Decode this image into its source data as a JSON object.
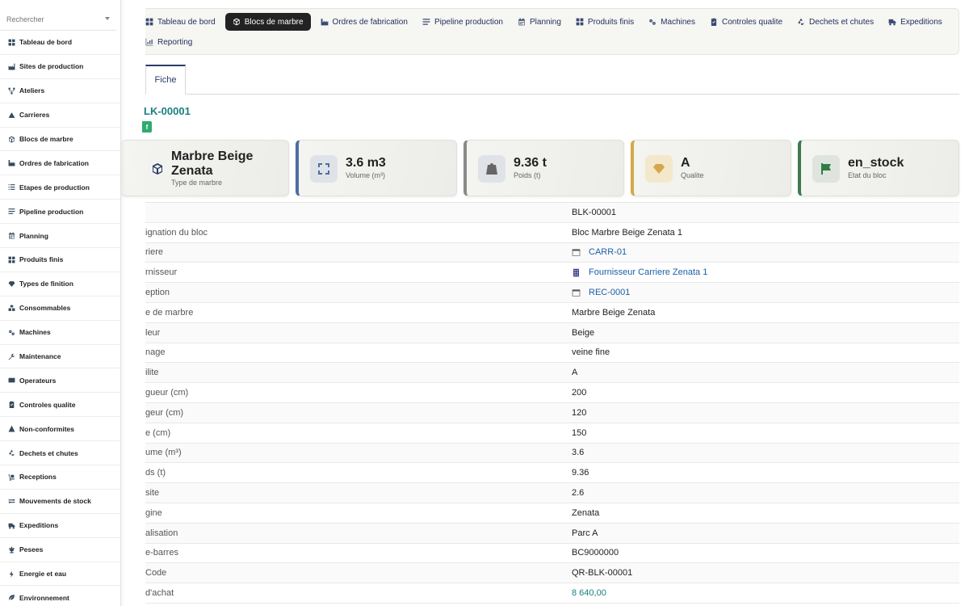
{
  "sidebar": {
    "search_placeholder": "Rechercher",
    "items": [
      {
        "label": "Tableau de bord",
        "icon": "dashboard-icon"
      },
      {
        "label": "Sites de production",
        "icon": "factory-icon"
      },
      {
        "label": "Ateliers",
        "icon": "network-icon"
      },
      {
        "label": "Carrieres",
        "icon": "mountain-icon"
      },
      {
        "label": "Blocs de marbre",
        "icon": "cube-icon"
      },
      {
        "label": "Ordres de fabrication",
        "icon": "industry-icon"
      },
      {
        "label": "Etapes de production",
        "icon": "list-icon"
      },
      {
        "label": "Pipeline production",
        "icon": "bars-icon"
      },
      {
        "label": "Planning",
        "icon": "calendar-icon"
      },
      {
        "label": "Produits finis",
        "icon": "grid-icon"
      },
      {
        "label": "Types de finition",
        "icon": "gem-icon"
      },
      {
        "label": "Consommables",
        "icon": "boxes-icon"
      },
      {
        "label": "Machines",
        "icon": "gears-icon"
      },
      {
        "label": "Maintenance",
        "icon": "wrench-icon"
      },
      {
        "label": "Operateurs",
        "icon": "id-card-icon"
      },
      {
        "label": "Controles qualite",
        "icon": "clipboard-check-icon"
      },
      {
        "label": "Non-conformites",
        "icon": "warning-icon"
      },
      {
        "label": "Dechets et chutes",
        "icon": "recycle-icon"
      },
      {
        "label": "Receptions",
        "icon": "dolly-icon"
      },
      {
        "label": "Mouvements de stock",
        "icon": "exchange-icon"
      },
      {
        "label": "Expeditions",
        "icon": "truck-icon"
      },
      {
        "label": "Pesees",
        "icon": "scale-icon"
      },
      {
        "label": "Energie et eau",
        "icon": "bolt-icon"
      },
      {
        "label": "Environnement",
        "icon": "leaf-icon"
      }
    ]
  },
  "topnav": {
    "row1": [
      {
        "label": "Tableau de bord",
        "icon": "dashboard-icon",
        "active": false
      },
      {
        "label": "Blocs de marbre",
        "icon": "cube-icon",
        "active": true
      },
      {
        "label": "Ordres de fabrication",
        "icon": "industry-icon",
        "active": false
      },
      {
        "label": "Pipeline production",
        "icon": "bars-icon",
        "active": false
      },
      {
        "label": "Planning",
        "icon": "calendar-icon",
        "active": false
      },
      {
        "label": "Produits finis",
        "icon": "grid-icon",
        "active": false
      },
      {
        "label": "Machines",
        "icon": "gears-icon",
        "active": false
      },
      {
        "label": "Controles qualite",
        "icon": "clipboard-check-icon",
        "active": false
      },
      {
        "label": "Dechets et chutes",
        "icon": "recycle-icon",
        "active": false
      },
      {
        "label": "Expeditions",
        "icon": "truck-icon",
        "active": false
      }
    ],
    "row2": [
      {
        "label": "Reporting",
        "icon": "chart-icon",
        "active": false
      }
    ]
  },
  "tabs": {
    "fiche": "Fiche"
  },
  "record": {
    "code": "LK-00001",
    "badge": "f"
  },
  "kpis": [
    {
      "value": "Marbre Beige Zenata",
      "label": "Type de marbre",
      "icon": "cube-icon",
      "accent": "#2b3a67",
      "icon_color": "#2b3a67"
    },
    {
      "value": "3.6 m3",
      "label": "Volume (m³)",
      "icon": "expand-icon",
      "accent": "#4a6fa5",
      "icon_color": "#4a6fa5"
    },
    {
      "value": "9.36 t",
      "label": "Poids (t)",
      "icon": "weight-icon",
      "accent": "#8a8a8a",
      "icon_color": "#666666"
    },
    {
      "value": "A",
      "label": "Qualite",
      "icon": "gem-icon",
      "accent": "#d4a84b",
      "icon_color": "#d4a84b"
    },
    {
      "value": "en_stock",
      "label": "Etat du bloc",
      "icon": "flag-icon",
      "accent": "#3d7a50",
      "icon_color": "#2e7d46"
    }
  ],
  "details": [
    {
      "label": "",
      "value": "BLK-00001",
      "type": "text"
    },
    {
      "label": "ignation du bloc",
      "value": "Bloc Marbre Beige Zenata 1",
      "type": "text"
    },
    {
      "label": "riere",
      "value": "CARR-01",
      "type": "link",
      "icon": "window-icon"
    },
    {
      "label": "rnisseur",
      "value": "Fournisseur Carriere Zenata 1",
      "type": "link",
      "icon": "building-icon"
    },
    {
      "label": "eption",
      "value": "REC-0001",
      "type": "link",
      "icon": "window-icon"
    },
    {
      "label": "e de marbre",
      "value": "Marbre Beige Zenata",
      "type": "text"
    },
    {
      "label": "leur",
      "value": "Beige",
      "type": "text"
    },
    {
      "label": "nage",
      "value": "veine fine",
      "type": "text"
    },
    {
      "label": "ilite",
      "value": "A",
      "type": "text"
    },
    {
      "label": "gueur (cm)",
      "value": "200",
      "type": "text"
    },
    {
      "label": "geur (cm)",
      "value": "120",
      "type": "text"
    },
    {
      "label": "e (cm)",
      "value": "150",
      "type": "text"
    },
    {
      "label": "ume (m³)",
      "value": "3.6",
      "type": "text"
    },
    {
      "label": "ds (t)",
      "value": "9.36",
      "type": "text"
    },
    {
      "label": "site",
      "value": "2.6",
      "type": "text"
    },
    {
      "label": "gine",
      "value": "Zenata",
      "type": "text"
    },
    {
      "label": "alisation",
      "value": "Parc A",
      "type": "text"
    },
    {
      "label": "e-barres",
      "value": "BC9000000",
      "type": "text"
    },
    {
      "label": "Code",
      "value": "QR-BLK-00001",
      "type": "text"
    },
    {
      "label": " d'achat",
      "value": "8 640,00",
      "type": "money"
    }
  ]
}
